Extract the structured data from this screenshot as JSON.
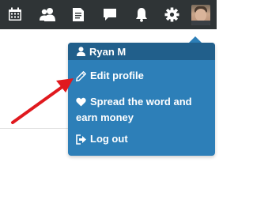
{
  "topbar": {
    "icons": [
      "calendar-icon",
      "people-icon",
      "document-icon",
      "chat-icon",
      "bell-icon",
      "gear-icon"
    ],
    "avatar": "user-avatar"
  },
  "dropdown": {
    "user_name": "Ryan M",
    "items": [
      {
        "label": "Edit profile",
        "icon": "pencil-icon"
      },
      {
        "label": "Spread the word and earn money",
        "icon": "heart-icon"
      },
      {
        "label": "Log out",
        "icon": "logout-icon"
      }
    ]
  },
  "colors": {
    "topbar": "#2f3436",
    "dropdown": "#2d7fb8",
    "dropdown_header": "#215f8b",
    "annotation_arrow": "#e0191e"
  }
}
